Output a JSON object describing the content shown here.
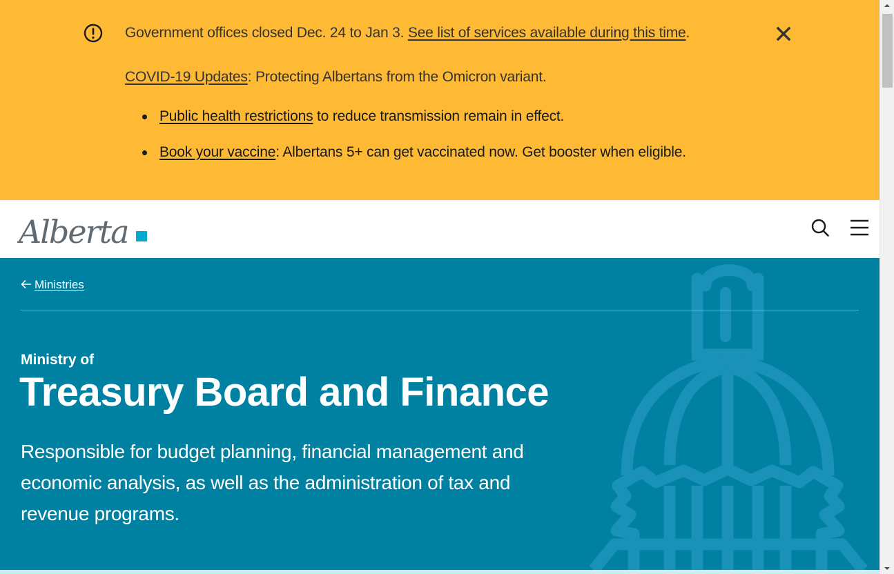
{
  "alert": {
    "line1_text": "Government offices closed Dec. 24 to Jan 3. ",
    "line1_link": "See list of services available during this time",
    "line1_end": ".",
    "line2_link": "COVID-19 Updates",
    "line2_text": ": Protecting Albertans from the Omicron variant.",
    "bullet1_link": "Public health restrictions",
    "bullet1_text": " to reduce transmission remain in effect.",
    "bullet2_link": "Book your vaccine",
    "bullet2_text": ": Albertans 5+ can get vaccinated now. Get booster when eligible.",
    "background_color": "#feba35"
  },
  "header": {
    "logo_text": "Alberta",
    "logo_accent_color": "#00aad2"
  },
  "hero": {
    "breadcrumb_label": "Ministries",
    "eyebrow": "Ministry of",
    "title": "Treasury Board and Finance",
    "description": "Responsible for budget planning, financial management and economic analysis, as well as the administration of tax and revenue programs.",
    "background_color": "#0081a2"
  },
  "icons": {
    "alert": "exclamation-circle-icon",
    "close": "close-icon",
    "search": "search-icon",
    "menu": "hamburger-menu-icon",
    "back": "arrow-left-icon",
    "decor": "legislature-dome-icon"
  }
}
